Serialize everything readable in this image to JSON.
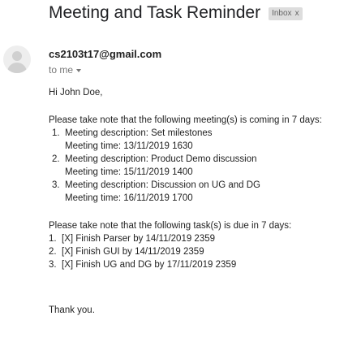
{
  "email": {
    "subject": "Meeting and Task Reminder",
    "label": "Inbox",
    "label_remove": "x",
    "sender": "cs2103t17@gmail.com",
    "to": "to me",
    "greeting": "Hi John Doe,",
    "meetings_intro": "Please take note that the following meeting(s) is coming in 7 days:",
    "meetings": [
      {
        "num": "1.",
        "description": "Meeting description: Set milestones",
        "time": "Meeting time: 13/11/2019 1630"
      },
      {
        "num": "2.",
        "description": "Meeting description: Product Demo discussion",
        "time": "Meeting time: 15/11/2019 1400"
      },
      {
        "num": "3.",
        "description": "Meeting description: Discussion on UG and DG",
        "time": "Meeting time: 16/11/2019 1700"
      }
    ],
    "tasks_intro": "Please take note that the following task(s) is due in 7 days:",
    "tasks": [
      {
        "num": "1.",
        "text": "[X] Finish Parser by 14/11/2019 2359"
      },
      {
        "num": "2.",
        "text": "[X] Finish GUI by 14/11/2019 2359"
      },
      {
        "num": "3.",
        "text": "[X] Finish UG and DG by 17/11/2019 2359"
      }
    ],
    "closing": "Thank you."
  }
}
